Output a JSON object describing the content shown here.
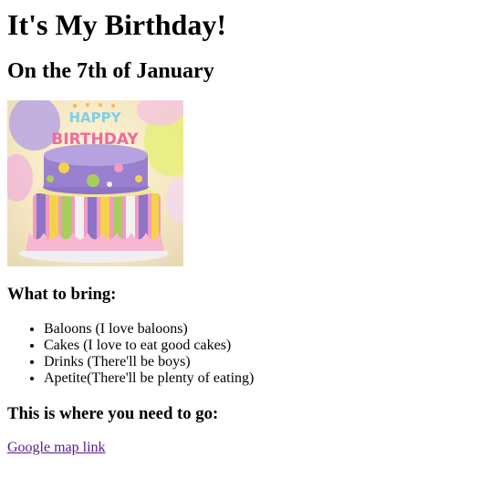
{
  "page": {
    "title": "It's My Birthday!",
    "subtitle": "On the 7th of January"
  },
  "image": {
    "icon": "birthday-cake-image",
    "banner_text": "HAPPY BIRTHDAY",
    "colors": {
      "background": "#f2e6c8",
      "cake_top": "#9a7fcf",
      "stripe_pink": "#f29ac4",
      "stripe_yellow": "#f5d24a",
      "stripe_green": "#a5cf5a",
      "frill": "#f7b7cf"
    }
  },
  "bring": {
    "heading": "What to bring:",
    "items": [
      "Baloons (I love baloons)",
      "Cakes (I love to eat good cakes)",
      "Drinks (There'll be boys)",
      "Apetite(There'll be plenty of eating)"
    ]
  },
  "location": {
    "heading": "This is where you need to go:",
    "link_text": "Google map link"
  },
  "colors": {
    "link_visited": "#551a8b",
    "text": "#000000",
    "background": "#ffffff"
  }
}
